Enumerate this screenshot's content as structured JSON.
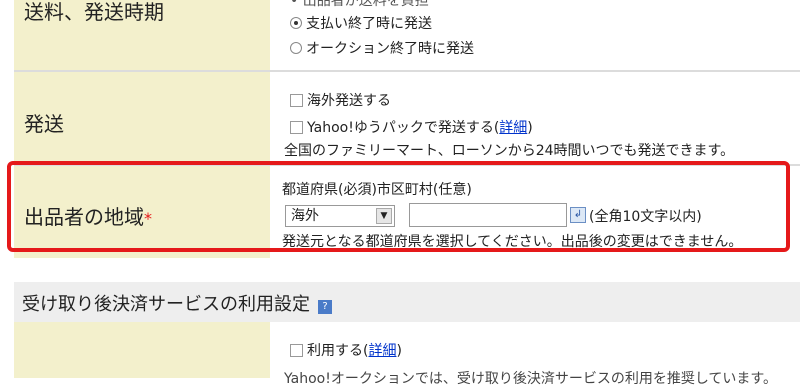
{
  "rows": {
    "shipping_time": {
      "label": "送料、発送時期",
      "cut_text": "• 出品者が送料を負担",
      "options": [
        {
          "label": "支払い終了時に発送",
          "selected": true
        },
        {
          "label": "オークション終了時に発送",
          "selected": false
        }
      ]
    },
    "shipping": {
      "label": "発送",
      "overseas_label": "海外発送する",
      "yupack_label": "Yahoo!ゆうパックで発送する(",
      "yupack_link": "詳細",
      "yupack_close": ")",
      "note": "全国のファミリーマート、ローソンから24時間いつでも発送できます。"
    },
    "region": {
      "label": "出品者の地域",
      "required_mark": "*",
      "sublabel": "都道府県(必須)市区町村(任意)",
      "select_value": "海外",
      "input_hint": "(全角10文字以内)",
      "note": "発送元となる都道府県を選択してください。出品後の変更はできません。"
    }
  },
  "payment_section": {
    "title": "受け取り後決済サービスの利用設定",
    "help_icon": "?",
    "use_label": "利用する(",
    "use_link": "詳細",
    "use_close": ")",
    "cut_text": "Yahoo!オークションでは、受け取り後決済サービスの利用を推奨しています。"
  },
  "colors": {
    "label_bg": "#f3f0cc",
    "highlight": "#e5191a",
    "link": "#0033cc",
    "required": "#e5191a"
  }
}
